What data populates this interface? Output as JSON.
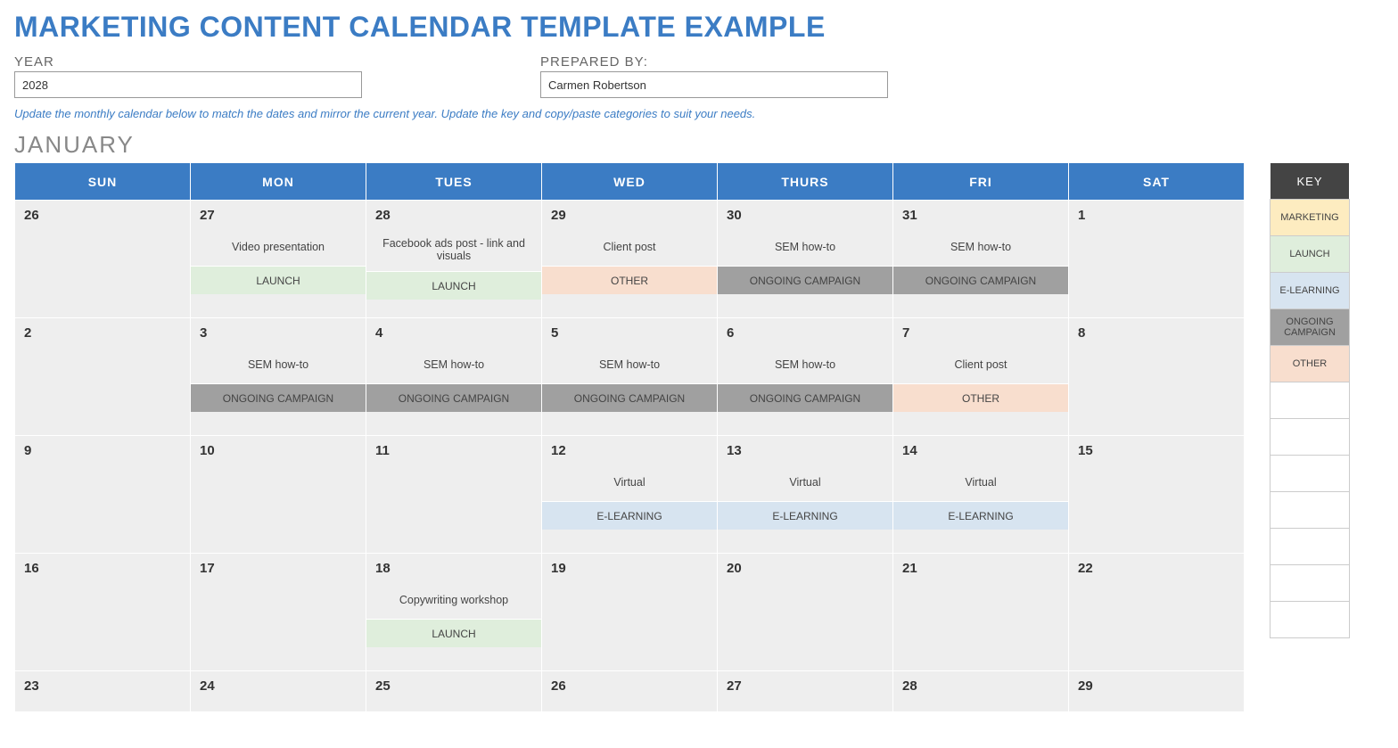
{
  "title": "MARKETING CONTENT CALENDAR TEMPLATE EXAMPLE",
  "fields": {
    "year_label": "YEAR",
    "year_value": "2028",
    "prepared_label": "PREPARED BY:",
    "prepared_value": "Carmen Robertson"
  },
  "hint": "Update the monthly calendar below to match the dates and mirror the current year. Update the key and copy/paste categories to suit your needs.",
  "month": "JANUARY",
  "weekdays": [
    "SUN",
    "MON",
    "TUES",
    "WED",
    "THURS",
    "FRI",
    "SAT"
  ],
  "key": {
    "header": "KEY",
    "items": [
      {
        "label": "MARKETING",
        "class": "cat-marketing"
      },
      {
        "label": "LAUNCH",
        "class": "cat-launch"
      },
      {
        "label": "E-LEARNING",
        "class": "cat-elearning"
      },
      {
        "label": "ONGOING CAMPAIGN",
        "class": "cat-ongoing"
      },
      {
        "label": "OTHER",
        "class": "cat-other"
      }
    ],
    "empty_rows": 7
  },
  "weeks": [
    [
      {
        "num": "26"
      },
      {
        "num": "27",
        "desc": "Video presentation",
        "cat": "LAUNCH",
        "catclass": "cat-launch"
      },
      {
        "num": "28",
        "desc": "Facebook ads post - link and visuals",
        "cat": "LAUNCH",
        "catclass": "cat-launch"
      },
      {
        "num": "29",
        "desc": "Client post",
        "cat": "OTHER",
        "catclass": "cat-other"
      },
      {
        "num": "30",
        "desc": "SEM how-to",
        "cat": "ONGOING CAMPAIGN",
        "catclass": "cat-ongoing"
      },
      {
        "num": "31",
        "desc": "SEM how-to",
        "cat": "ONGOING CAMPAIGN",
        "catclass": "cat-ongoing"
      },
      {
        "num": "1"
      }
    ],
    [
      {
        "num": "2"
      },
      {
        "num": "3",
        "desc": "SEM how-to",
        "cat": "ONGOING CAMPAIGN",
        "catclass": "cat-ongoing"
      },
      {
        "num": "4",
        "desc": "SEM how-to",
        "cat": "ONGOING CAMPAIGN",
        "catclass": "cat-ongoing"
      },
      {
        "num": "5",
        "desc": "SEM how-to",
        "cat": "ONGOING CAMPAIGN",
        "catclass": "cat-ongoing"
      },
      {
        "num": "6",
        "desc": "SEM how-to",
        "cat": "ONGOING CAMPAIGN",
        "catclass": "cat-ongoing"
      },
      {
        "num": "7",
        "desc": "Client post",
        "cat": "OTHER",
        "catclass": "cat-other"
      },
      {
        "num": "8"
      }
    ],
    [
      {
        "num": "9"
      },
      {
        "num": "10"
      },
      {
        "num": "11"
      },
      {
        "num": "12",
        "desc": "Virtual",
        "cat": "E-LEARNING",
        "catclass": "cat-elearning"
      },
      {
        "num": "13",
        "desc": "Virtual",
        "cat": "E-LEARNING",
        "catclass": "cat-elearning"
      },
      {
        "num": "14",
        "desc": "Virtual",
        "cat": "E-LEARNING",
        "catclass": "cat-elearning"
      },
      {
        "num": "15"
      }
    ],
    [
      {
        "num": "16"
      },
      {
        "num": "17"
      },
      {
        "num": "18",
        "desc": "Copywriting workshop",
        "cat": "LAUNCH",
        "catclass": "cat-launch"
      },
      {
        "num": "19"
      },
      {
        "num": "20"
      },
      {
        "num": "21"
      },
      {
        "num": "22"
      }
    ],
    [
      {
        "num": "23"
      },
      {
        "num": "24"
      },
      {
        "num": "25"
      },
      {
        "num": "26"
      },
      {
        "num": "27"
      },
      {
        "num": "28"
      },
      {
        "num": "29"
      }
    ]
  ]
}
